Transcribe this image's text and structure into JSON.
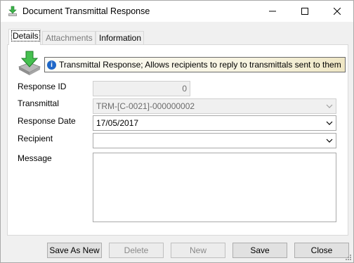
{
  "window": {
    "title": "Document Transmittal Response"
  },
  "tabs": [
    {
      "label": "Details"
    },
    {
      "label": "Attachments"
    },
    {
      "label": "Information"
    }
  ],
  "banner": {
    "text": "Transmittal Response; Allows recipients to reply to transmittals sent to them"
  },
  "form": {
    "response_id": {
      "label": "Response ID",
      "value": "0"
    },
    "transmittal": {
      "label": "Transmittal",
      "value": "TRM-[C-0021]-000000002"
    },
    "response_date": {
      "label": "Response Date",
      "value": "17/05/2017"
    },
    "recipient": {
      "label": "Recipient",
      "value": ""
    },
    "message": {
      "label": "Message",
      "value": ""
    }
  },
  "buttons": {
    "save_as_new": "Save As New",
    "delete": "Delete",
    "new": "New",
    "save": "Save",
    "close": "Close"
  },
  "icons": {
    "title": "download-arrow-icon",
    "header": "download-tray-icon",
    "info": "info-icon"
  },
  "colors": {
    "accent_green": "#3db14a",
    "info_blue": "#1f67c7"
  }
}
